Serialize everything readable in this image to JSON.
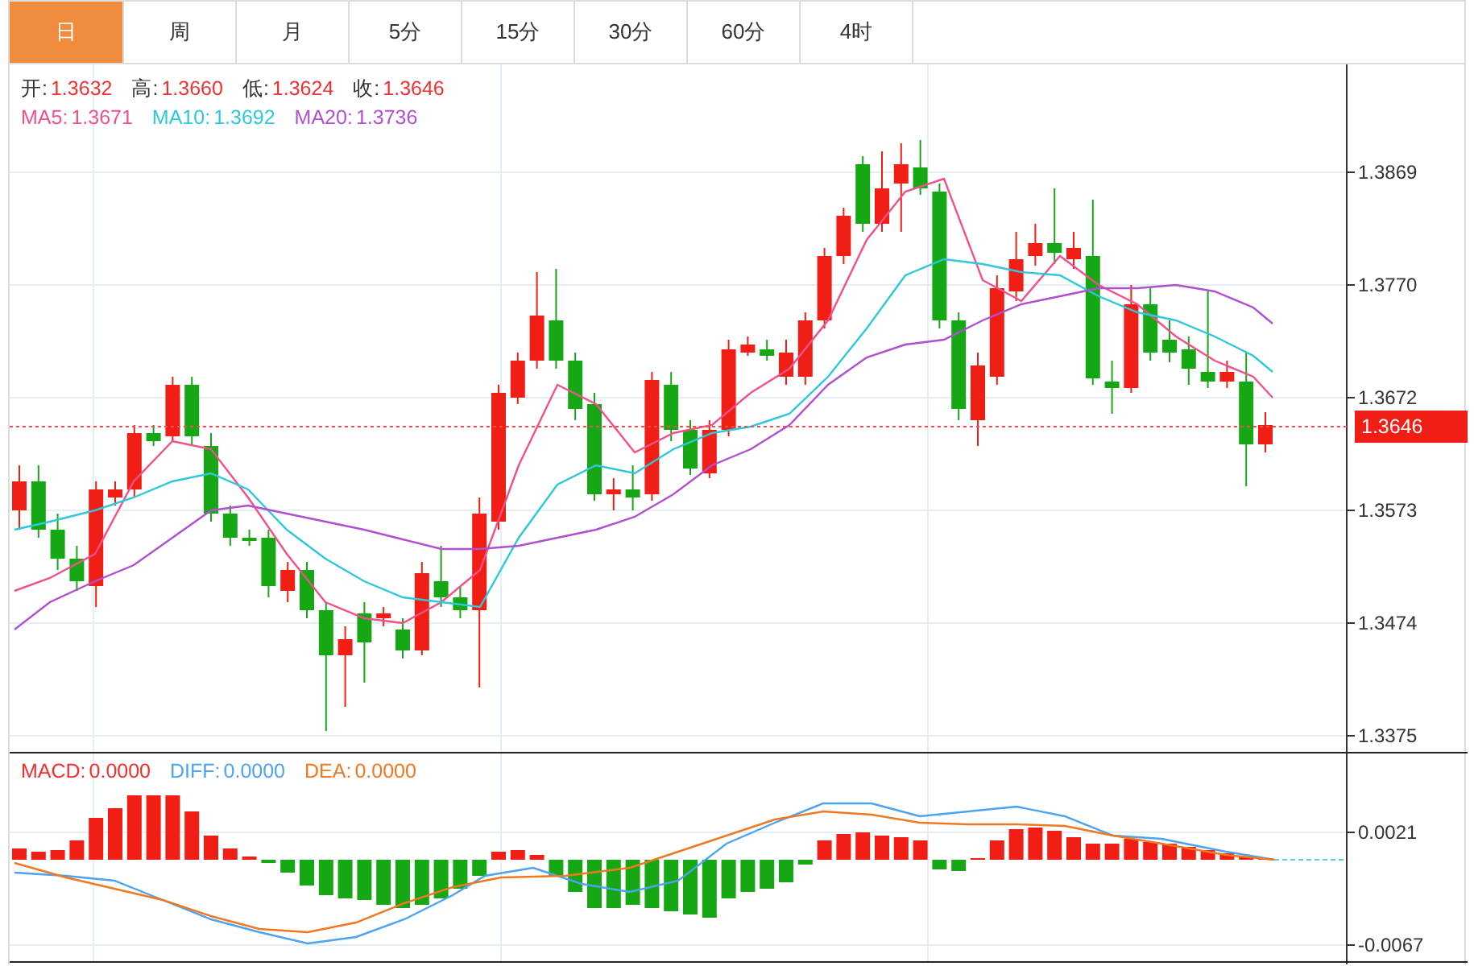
{
  "tabs": [
    {
      "label": "日",
      "selected": true
    },
    {
      "label": "周",
      "selected": false
    },
    {
      "label": "月",
      "selected": false
    },
    {
      "label": "5分",
      "selected": false
    },
    {
      "label": "15分",
      "selected": false
    },
    {
      "label": "30分",
      "selected": false
    },
    {
      "label": "60分",
      "selected": false
    },
    {
      "label": "4时",
      "selected": false
    }
  ],
  "ohlc_legend": [
    {
      "label": "开:",
      "value": "1.3632"
    },
    {
      "label": "高:",
      "value": "1.3660"
    },
    {
      "label": "低:",
      "value": "1.3624"
    },
    {
      "label": "收:",
      "value": "1.3646"
    }
  ],
  "ma_legend": [
    {
      "label": "MA5:",
      "value": "1.3671",
      "color": "#f0508c"
    },
    {
      "label": "MA10:",
      "value": "1.3692",
      "color": "#2ec7dc"
    },
    {
      "label": "MA20:",
      "value": "1.3736",
      "color": "#b04fd0"
    }
  ],
  "price_axis": [
    "1.3869",
    "1.3770",
    "1.3672",
    "1.3573",
    "1.3474",
    "1.3375"
  ],
  "current_price": "1.3646",
  "macd_legend": [
    {
      "label": "MACD:",
      "value": "0.0000",
      "color": "#f03030"
    },
    {
      "label": "DIFF:",
      "value": "0.0000",
      "color": "#4ca3f0"
    },
    {
      "label": "DEA:",
      "value": "0.0000",
      "color": "#f07820"
    }
  ],
  "macd_axis": [
    "0.0021",
    "-0.0067"
  ]
}
